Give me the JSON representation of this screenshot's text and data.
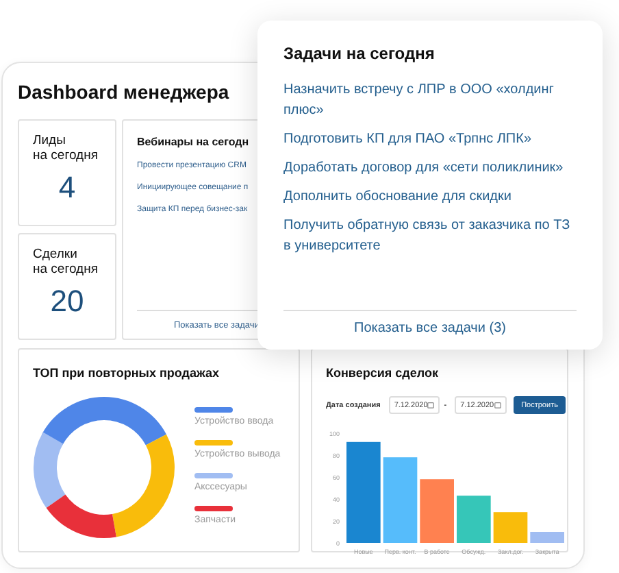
{
  "dashboard": {
    "title": "Dashboard менеджера",
    "stats": [
      {
        "label": "Лиды\nна сегодня",
        "value": "4"
      },
      {
        "label": "Сделки\nна сегодня",
        "value": "20"
      }
    ],
    "webinars": {
      "title": "Вебинары на сегодн",
      "items": [
        "Провести презентацию CRM",
        "Инициирующее совещание п",
        "Защита КП перед бизнес-зак"
      ],
      "link": "Показать все задачи"
    },
    "top_sales": {
      "title": "ТОП при повторных продажах",
      "legend": [
        {
          "label": "Устройство ввода",
          "color": "#4f86e8"
        },
        {
          "label": "Устройство вывода",
          "color": "#f9bc0b"
        },
        {
          "label": "Акссесуары",
          "color": "#a1bdf2"
        },
        {
          "label": "Запчасти",
          "color": "#e8303a"
        }
      ]
    },
    "conversion": {
      "title": "Конверсия сделок",
      "date_label": "Дата создания",
      "date_from": "7.12.2020",
      "date_separator": "-",
      "date_to": "7.12.2020",
      "build_button": "Построить",
      "chart_data": {
        "type": "bar",
        "categories": [
          "Новые",
          "Перв. конт.",
          "В работе",
          "Обсужд.",
          "Закл.дог.",
          "Закрыта"
        ],
        "series": [
          {
            "values": [
              92,
              78,
              58,
              43,
              28,
              10
            ]
          }
        ],
        "colors": [
          "#1a86d0",
          "#56bcfb",
          "#ff8150",
          "#36c6b8",
          "#f9bc0b",
          "#a1bdf2"
        ],
        "ylim": [
          0,
          100
        ],
        "yticks": [
          0,
          20,
          40,
          60,
          80,
          100
        ]
      }
    }
  },
  "tasks_popup": {
    "title": "Задачи на сегодня",
    "items": [
      "Назначить встречу с ЛПР в ООО «холдинг плюс»",
      "Подготовить КП для ПАО «Трпнс ЛПК»",
      "Доработать договор для «сети поликлиник»",
      "Дополнить обоснование для скидки",
      "Получить обратную связь от заказчика по ТЗ в университете"
    ],
    "link": "Показать все задачи (3)"
  }
}
